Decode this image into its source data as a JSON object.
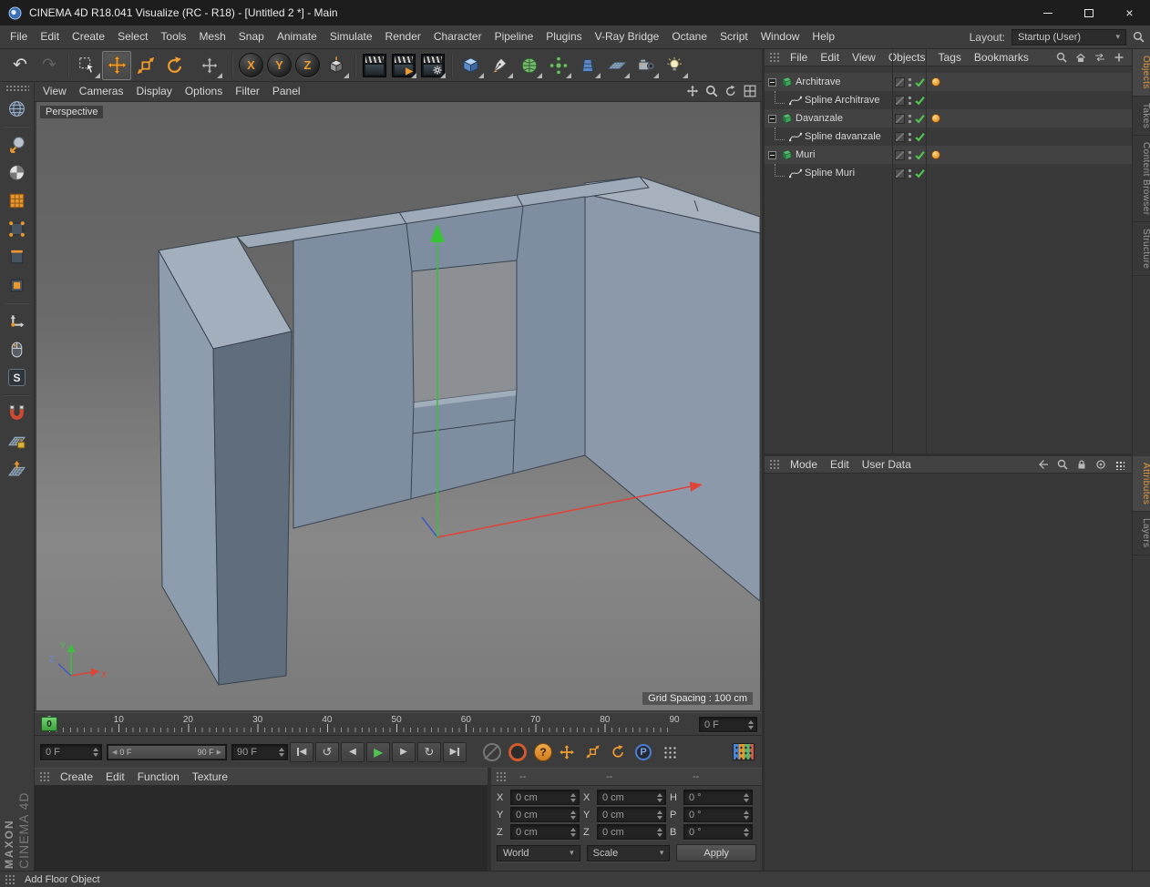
{
  "colors": {
    "accent_orange": "#ef9b2e",
    "axis_x_red": "#e04338",
    "axis_y_green": "#35c435",
    "axis_z_blue": "#3d59c6",
    "check_green": "#53c453",
    "wall_face": "#7e8d9f",
    "wall_top": "#a3afbc",
    "wall_dark": "#5f6d7c",
    "viewport_gray": "#6e6e6e"
  },
  "icons": {
    "close": "×",
    "caret_down": "▾",
    "undo": "↶",
    "redo": "↷",
    "step_back": "◀",
    "step_forward": "▶",
    "play": "▶",
    "play_backward": "↺",
    "loop": "↻",
    "question": "?",
    "letter_p": "P",
    "letter_s": "S"
  },
  "titlebar": {
    "title": "CINEMA 4D R18.041 Visualize (RC - R18) - [Untitled 2 *] - Main"
  },
  "menubar": {
    "items": [
      "File",
      "Edit",
      "Create",
      "Select",
      "Tools",
      "Mesh",
      "Snap",
      "Animate",
      "Simulate",
      "Render",
      "Character",
      "Pipeline",
      "Plugins",
      "V-Ray Bridge",
      "Octane",
      "Script",
      "Window",
      "Help"
    ],
    "layout_label": "Layout:",
    "layout_value": "Startup (User)"
  },
  "toolbar": {
    "axis_buttons": [
      "X",
      "Y",
      "Z"
    ]
  },
  "viewport": {
    "menu": [
      "View",
      "Cameras",
      "Display",
      "Options",
      "Filter",
      "Panel"
    ],
    "camera": "Perspective",
    "grid_spacing": "Grid Spacing : 100 cm",
    "axis_labels": {
      "x": "X",
      "y": "Y",
      "z": "Z"
    }
  },
  "object_manager": {
    "menu": [
      "File",
      "Edit",
      "View",
      "Objects",
      "Tags",
      "Bookmarks"
    ],
    "items": [
      {
        "name": "Architrave",
        "cls": "parent"
      },
      {
        "name": "Spline Architrave",
        "cls": "child"
      },
      {
        "name": "Davanzale",
        "cls": "parent"
      },
      {
        "name": "Spline davanzale",
        "cls": "child"
      },
      {
        "name": "Muri",
        "cls": "parent"
      },
      {
        "name": "Spline Muri",
        "cls": "child"
      }
    ]
  },
  "attribute_manager": {
    "menu": [
      "Mode",
      "Edit",
      "User Data"
    ]
  },
  "side_tabs": {
    "top": [
      {
        "label": "Objects",
        "cls": "active"
      },
      {
        "label": "Takes",
        "cls": ""
      },
      {
        "label": "Content Browser",
        "cls": ""
      },
      {
        "label": "Structure",
        "cls": ""
      }
    ],
    "bottom": [
      {
        "label": "Attributes",
        "cls": "active"
      },
      {
        "label": "Layers",
        "cls": ""
      }
    ]
  },
  "timeline": {
    "marker": "0",
    "ticks": [
      "0",
      "10",
      "20",
      "30",
      "40",
      "50",
      "60",
      "70",
      "80",
      "90"
    ],
    "frame_field": "0 F"
  },
  "transport": {
    "start_field": "0 F",
    "range_start": "0 F",
    "range_end": "90 F",
    "end_field": "90 F"
  },
  "materials": {
    "menu": [
      "Create",
      "Edit",
      "Function",
      "Texture"
    ]
  },
  "coordinates": {
    "headers": [
      "--",
      "--",
      "--"
    ],
    "rows": [
      {
        "l1": "X",
        "v1": "0 cm",
        "l2": "X",
        "v2": "0 cm",
        "l3": "H",
        "v3": "0 °"
      },
      {
        "l1": "Y",
        "v1": "0 cm",
        "l2": "Y",
        "v2": "0 cm",
        "l3": "P",
        "v3": "0 °"
      },
      {
        "l1": "Z",
        "v1": "0 cm",
        "l2": "Z",
        "v2": "0 cm",
        "l3": "B",
        "v3": "0 °"
      }
    ],
    "transform_mode": "World",
    "size_mode": "Scale",
    "apply": "Apply"
  },
  "statusbar": {
    "text": "Add Floor Object"
  },
  "branding": {
    "line1": "MAXON",
    "line2": "CINEMA 4D"
  }
}
